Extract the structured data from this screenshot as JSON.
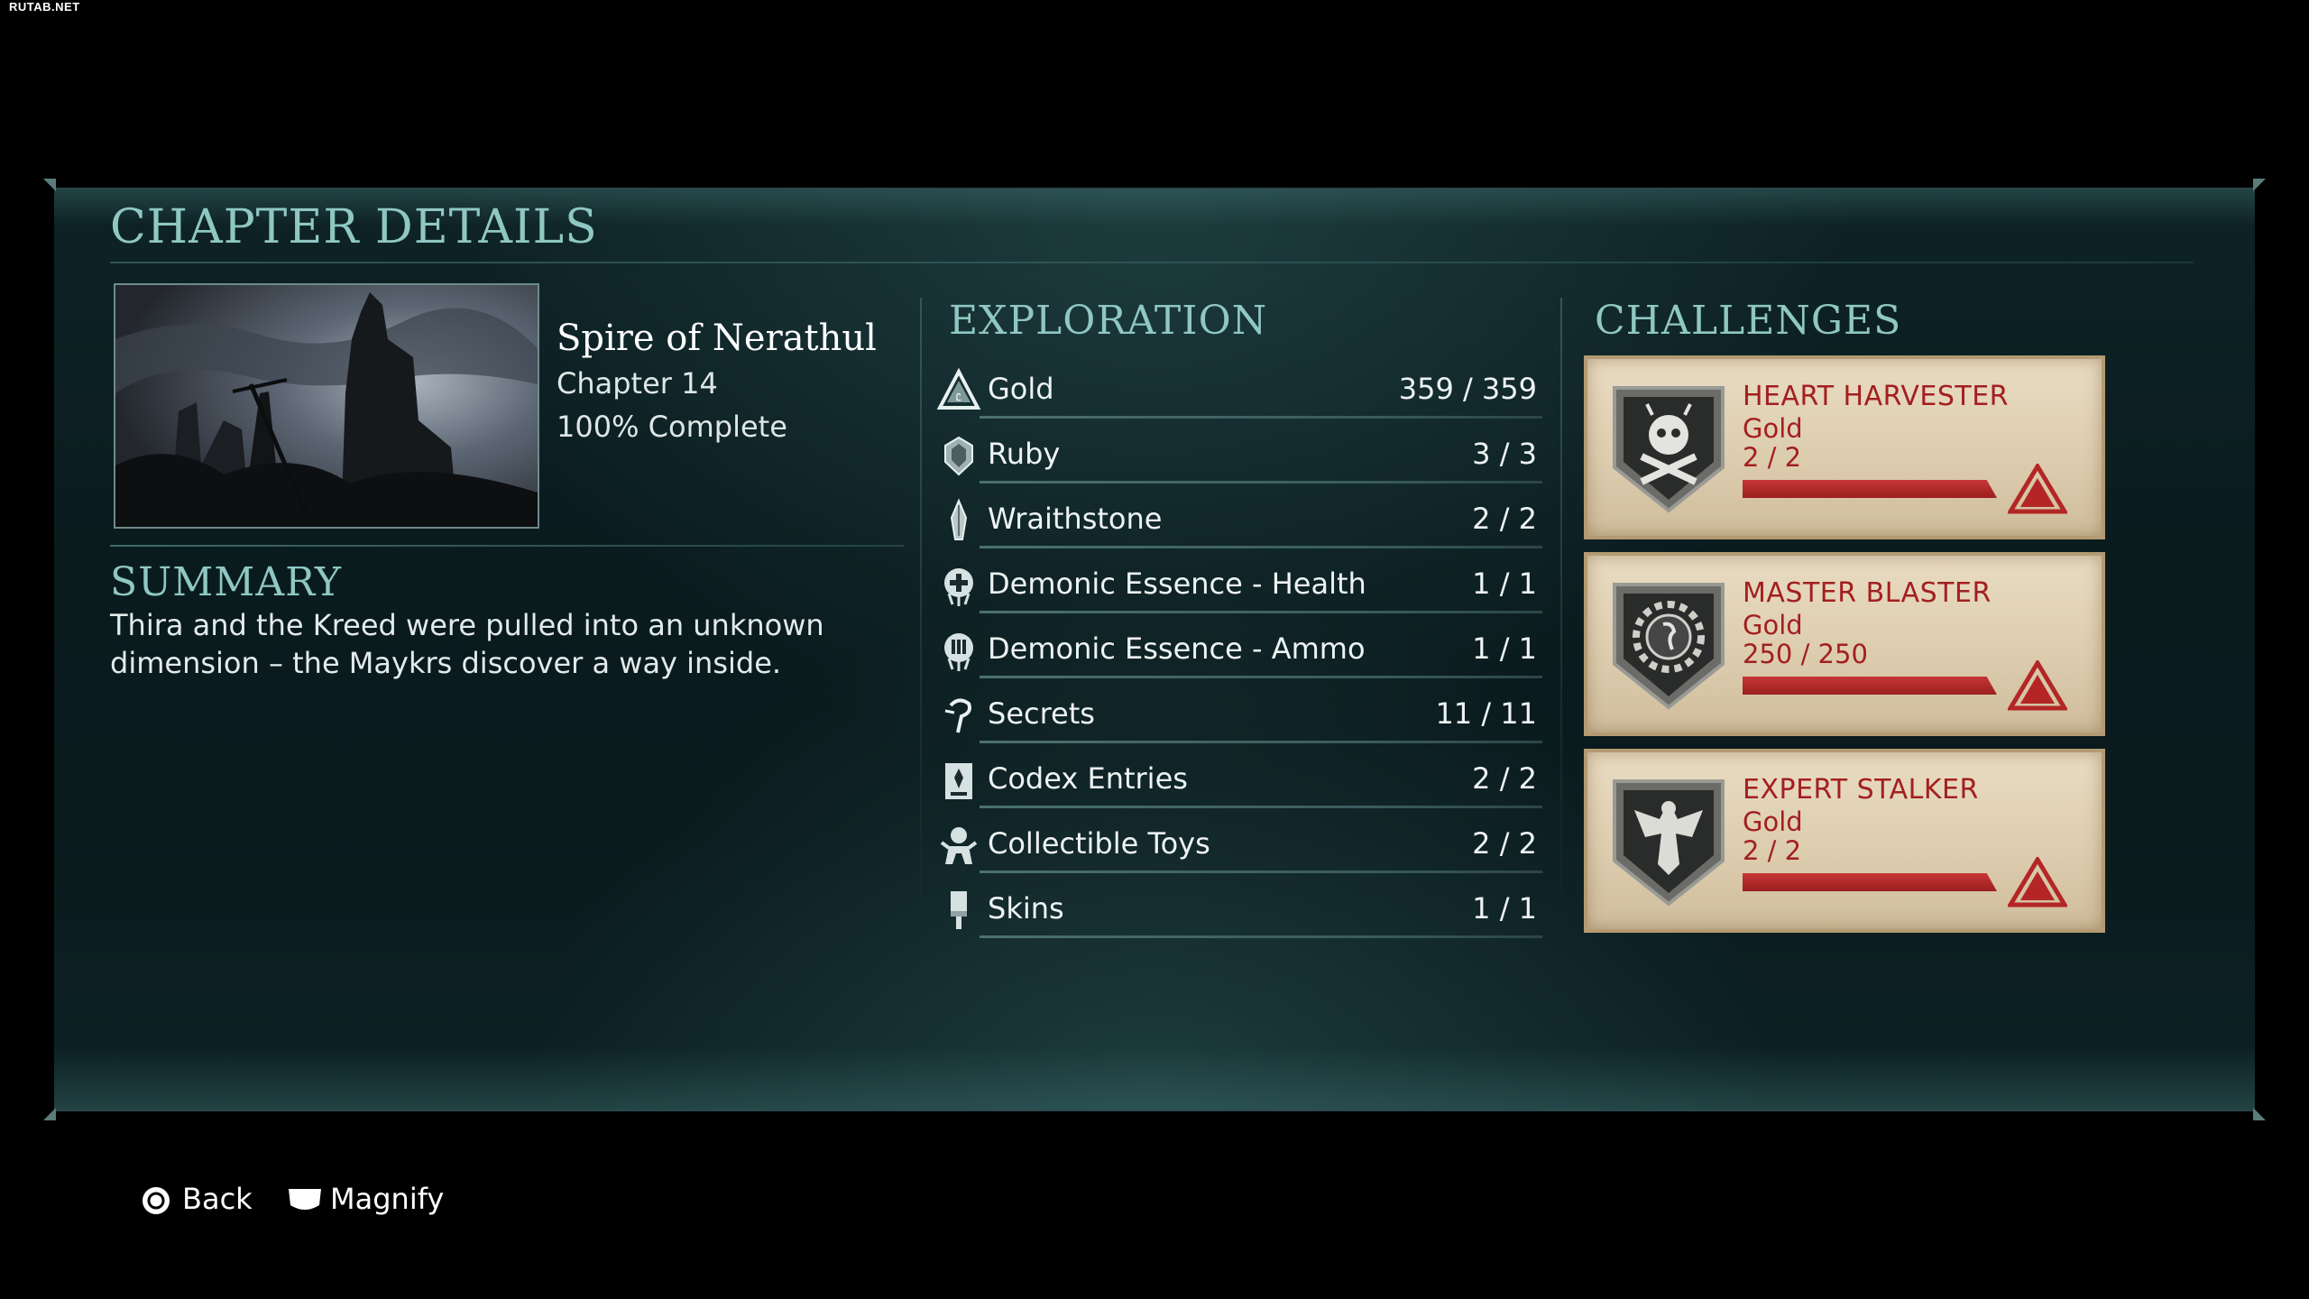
{
  "watermark": "RUTAB.NET",
  "panel": {
    "title": "CHAPTER DETAILS"
  },
  "chapter": {
    "name": "Spire of Nerathul",
    "number": "Chapter 14",
    "completion": "100% Complete",
    "image_icon": "castle-ruins-thumbnail"
  },
  "summary": {
    "title": "SUMMARY",
    "text": "Thira and the Kreed were pulled into an unknown dimension – the Maykrs discover a way inside."
  },
  "exploration": {
    "title": "EXPLORATION",
    "items": [
      {
        "icon": "gold-icon",
        "label": "Gold",
        "value": "359 / 359"
      },
      {
        "icon": "ruby-icon",
        "label": "Ruby",
        "value": "3 / 3"
      },
      {
        "icon": "wraithstone-icon",
        "label": "Wraithstone",
        "value": "2 / 2"
      },
      {
        "icon": "health-essence-icon",
        "label": "Demonic Essence - Health",
        "value": "1 / 1"
      },
      {
        "icon": "ammo-essence-icon",
        "label": "Demonic Essence - Ammo",
        "value": "1 / 1"
      },
      {
        "icon": "secrets-icon",
        "label": "Secrets",
        "value": "11 / 11"
      },
      {
        "icon": "codex-icon",
        "label": "Codex Entries",
        "value": "2 / 2"
      },
      {
        "icon": "toy-icon",
        "label": "Collectible Toys",
        "value": "2 / 2"
      },
      {
        "icon": "skins-icon",
        "label": "Skins",
        "value": "1 / 1"
      }
    ]
  },
  "challenges": {
    "title": "CHALLENGES",
    "items": [
      {
        "icon": "skull-crossbones-badge-icon",
        "title": "HEART HARVESTER",
        "tier": "Gold",
        "progress": "2 / 2",
        "progress_fraction": 1.0
      },
      {
        "icon": "cog-skull-badge-icon",
        "title": "MASTER BLASTER",
        "tier": "Gold",
        "progress": "250 / 250",
        "progress_fraction": 1.0
      },
      {
        "icon": "winged-demon-badge-icon",
        "title": "EXPERT STALKER",
        "tier": "Gold",
        "progress": "2 / 2",
        "progress_fraction": 1.0
      }
    ]
  },
  "footer": {
    "back_label": "Back",
    "magnify_label": "Magnify"
  },
  "colors": {
    "accent_teal": "#8fc7c3",
    "challenge_red": "#a31f1f",
    "card_parchment": "#e9dcc2"
  }
}
